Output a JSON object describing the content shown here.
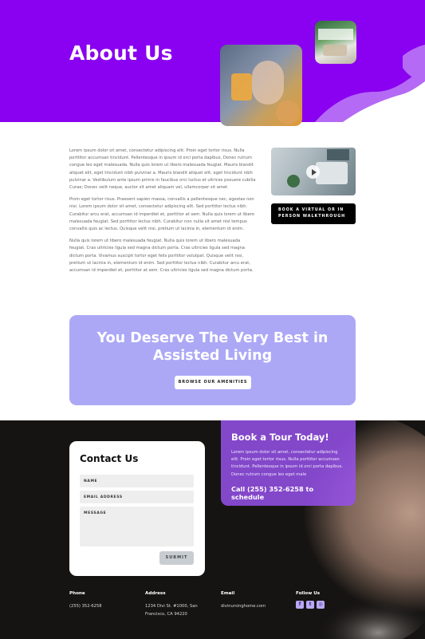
{
  "hero": {
    "title": "About Us",
    "bg_color": "#8a00f0",
    "wave_color": "#b46af4"
  },
  "about": {
    "paragraphs": [
      "Lorem ipsum dolor sit amet, consectetur adipiscing elit. Proin eget tortor risus. Nulla porttitor accumsan tincidunt. Pellentesque in ipsum id orci porta dapibus. Donec rutrum congue leo eget malesuada. Nulla quis lorem ut libero malesuada feugiat. Mauris blandit aliquet elit, eget tincidunt nibh pulvinar a. Mauris blandit aliquet elit, eget tincidunt nibh pulvinar a. Vestibulum ante ipsum primis in faucibus orci luctus et ultrices posuere cubilia Curae; Donec velit neque, auctor sit amet aliquam vel, ullamcorper sit amet",
      "Proin eget tortor risus. Praesent sapien massa, convallis a pellentesque nec, egestas non nisi. Lorem ipsum dolor sit amet, consectetur adipiscing elit. Sed porttitor lectus nibh. Curabitur arcu erat, accumsan id imperdiet et, porttitor at sem. Nulla quis lorem ut libero malesuada feugiat. Sed porttitor lectus nibh. Curabitur non nulla sit amet nisl tempus convallis quis ac lectus. Quisque velit nisi, pretium ut lacinia in, elementum id enim.",
      "Nulla quis lorem ut libero malesuada feugiat. Nulla quis lorem ut libero malesuada feugiat. Cras ultricies ligula sed magna dictum porta. Cras ultricies ligula sed magna dictum porta. Vivamus suscipit tortor eget felis porttitor volutpat. Quisque velit nisi, pretium ut lacinia in, elementum id enim. Sed porttitor lectus nibh. Curabitur arcu erat, accumsan id imperdiet et, porttitor at sem. Cras ultricies ligula sed magna dictum porta."
    ],
    "video_icon": "play-icon",
    "tour_button": "BOOK A VIRTUAL OR IN PERSON WALKTHROUGH"
  },
  "cta": {
    "title": "You Deserve The Very Best in Assisted Living",
    "button": "BROWSE OUR AMENITIES",
    "bg_color": "#aca8f6"
  },
  "contact": {
    "title": "Contact Us",
    "name_placeholder": "NAME",
    "email_placeholder": "EMAIL ADDRESS",
    "message_placeholder": "MESSAGE",
    "submit": "SUBMIT"
  },
  "book": {
    "title": "Book a Tour Today!",
    "text": "Lorem ipsum dolor sit amet, consectetur adipiscing elit. Proin eget tortor risus. Nulla porttitor accumsan tincidunt. Pellentesque in ipsum id orci porta dapibus. Donec rutrum congue leo eget male",
    "call": "Call (255) 352-6258 to schedule"
  },
  "footer": {
    "phone_label": "Phone",
    "phone": "(255) 352-6258",
    "address_label": "Address",
    "address_line1": "1234 Divi St. #1000, San",
    "address_line2": "Francisco, CA 94220",
    "email_label": "Email",
    "email": "divinursinghome.com",
    "follow_label": "Follow Us",
    "social_icons": [
      "facebook-icon",
      "twitter-icon",
      "instagram-icon"
    ]
  }
}
